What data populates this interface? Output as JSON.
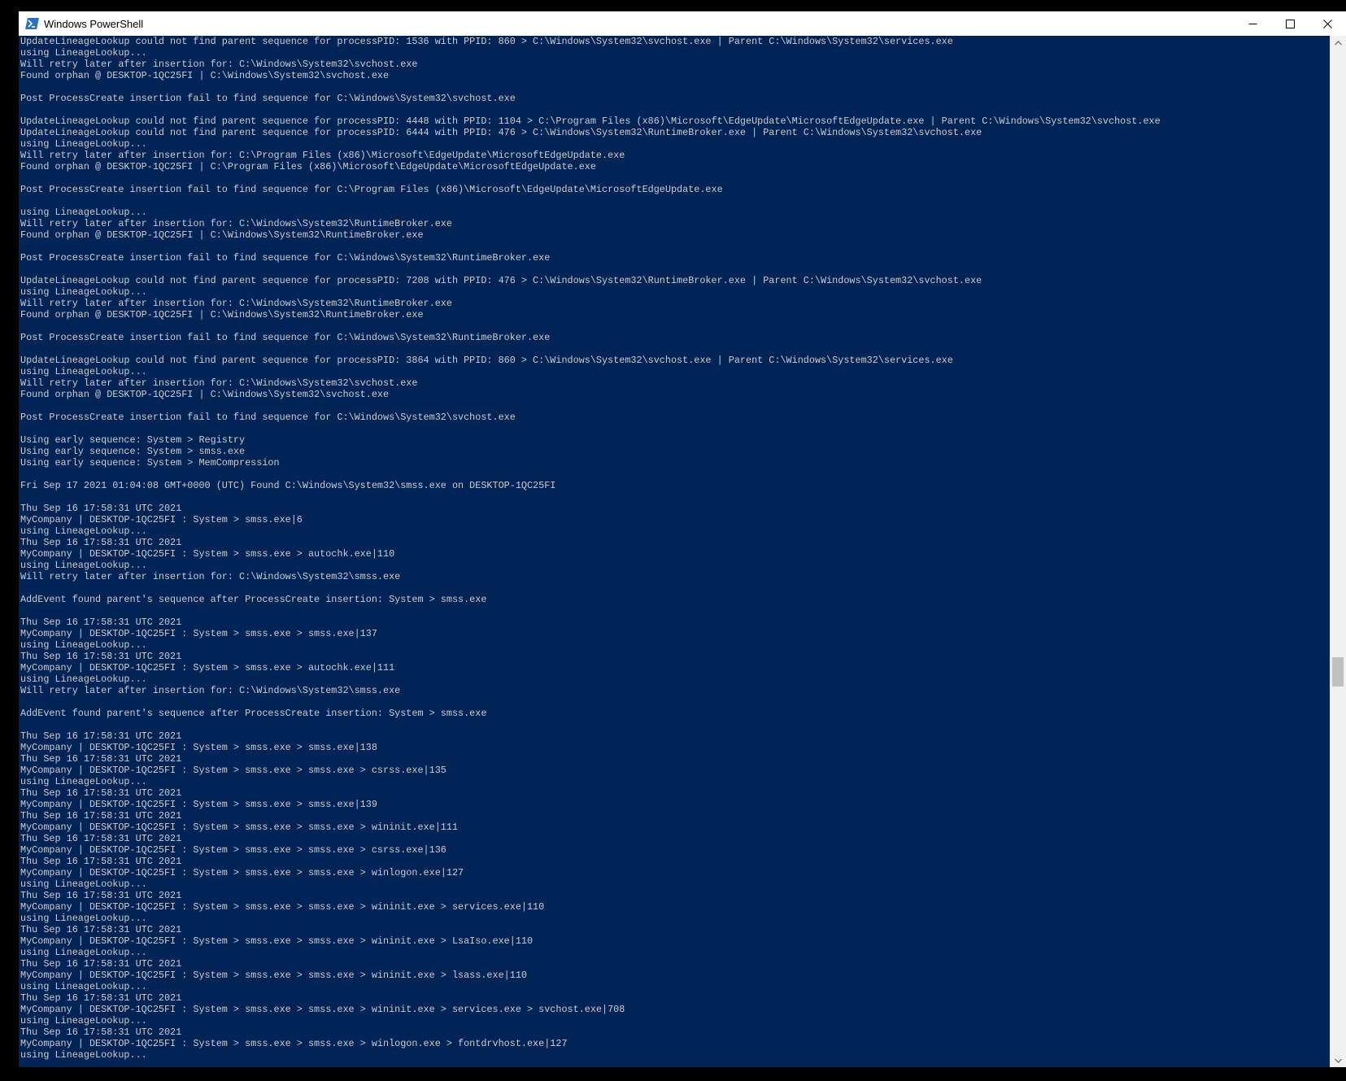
{
  "window": {
    "title": "Windows PowerShell",
    "icon": "powershell-icon",
    "controls": [
      "minimize-icon",
      "maximize-icon",
      "close-icon"
    ]
  },
  "colors": {
    "console_bg": "#012456",
    "console_fg": "#cccccc",
    "titlebar_bg": "#ffffff"
  },
  "console": {
    "lines": [
      "UpdateLineageLookup could not find parent sequence for processPID: 1536 with PPID: 860 > C:\\Windows\\System32\\svchost.exe | Parent C:\\Windows\\System32\\services.exe",
      "using LineageLookup...",
      "Will retry later after insertion for: C:\\Windows\\System32\\svchost.exe",
      "Found orphan @ DESKTOP-1QC25FI | C:\\Windows\\System32\\svchost.exe",
      "",
      "Post ProcessCreate insertion fail to find sequence for C:\\Windows\\System32\\svchost.exe",
      "",
      "UpdateLineageLookup could not find parent sequence for processPID: 4448 with PPID: 1104 > C:\\Program Files (x86)\\Microsoft\\EdgeUpdate\\MicrosoftEdgeUpdate.exe | Parent C:\\Windows\\System32\\svchost.exe",
      "UpdateLineageLookup could not find parent sequence for processPID: 6444 with PPID: 476 > C:\\Windows\\System32\\RuntimeBroker.exe | Parent C:\\Windows\\System32\\svchost.exe",
      "using LineageLookup...",
      "Will retry later after insertion for: C:\\Program Files (x86)\\Microsoft\\EdgeUpdate\\MicrosoftEdgeUpdate.exe",
      "Found orphan @ DESKTOP-1QC25FI | C:\\Program Files (x86)\\Microsoft\\EdgeUpdate\\MicrosoftEdgeUpdate.exe",
      "",
      "Post ProcessCreate insertion fail to find sequence for C:\\Program Files (x86)\\Microsoft\\EdgeUpdate\\MicrosoftEdgeUpdate.exe",
      "",
      "using LineageLookup...",
      "Will retry later after insertion for: C:\\Windows\\System32\\RuntimeBroker.exe",
      "Found orphan @ DESKTOP-1QC25FI | C:\\Windows\\System32\\RuntimeBroker.exe",
      "",
      "Post ProcessCreate insertion fail to find sequence for C:\\Windows\\System32\\RuntimeBroker.exe",
      "",
      "UpdateLineageLookup could not find parent sequence for processPID: 7208 with PPID: 476 > C:\\Windows\\System32\\RuntimeBroker.exe | Parent C:\\Windows\\System32\\svchost.exe",
      "using LineageLookup...",
      "Will retry later after insertion for: C:\\Windows\\System32\\RuntimeBroker.exe",
      "Found orphan @ DESKTOP-1QC25FI | C:\\Windows\\System32\\RuntimeBroker.exe",
      "",
      "Post ProcessCreate insertion fail to find sequence for C:\\Windows\\System32\\RuntimeBroker.exe",
      "",
      "UpdateLineageLookup could not find parent sequence for processPID: 3864 with PPID: 860 > C:\\Windows\\System32\\svchost.exe | Parent C:\\Windows\\System32\\services.exe",
      "using LineageLookup...",
      "Will retry later after insertion for: C:\\Windows\\System32\\svchost.exe",
      "Found orphan @ DESKTOP-1QC25FI | C:\\Windows\\System32\\svchost.exe",
      "",
      "Post ProcessCreate insertion fail to find sequence for C:\\Windows\\System32\\svchost.exe",
      "",
      "Using early sequence: System > Registry",
      "Using early sequence: System > smss.exe",
      "Using early sequence: System > MemCompression",
      "",
      "Fri Sep 17 2021 01:04:08 GMT+0000 (UTC) Found C:\\Windows\\System32\\smss.exe on DESKTOP-1QC25FI",
      "",
      "Thu Sep 16 17:58:31 UTC 2021",
      "MyCompany | DESKTOP-1QC25FI : System > smss.exe|6",
      "using LineageLookup...",
      "Thu Sep 16 17:58:31 UTC 2021",
      "MyCompany | DESKTOP-1QC25FI : System > smss.exe > autochk.exe|110",
      "using LineageLookup...",
      "Will retry later after insertion for: C:\\Windows\\System32\\smss.exe",
      "",
      "AddEvent found parent's sequence after ProcessCreate insertion: System > smss.exe",
      "",
      "Thu Sep 16 17:58:31 UTC 2021",
      "MyCompany | DESKTOP-1QC25FI : System > smss.exe > smss.exe|137",
      "using LineageLookup...",
      "Thu Sep 16 17:58:31 UTC 2021",
      "MyCompany | DESKTOP-1QC25FI : System > smss.exe > autochk.exe|111",
      "using LineageLookup...",
      "Will retry later after insertion for: C:\\Windows\\System32\\smss.exe",
      "",
      "AddEvent found parent's sequence after ProcessCreate insertion: System > smss.exe",
      "",
      "Thu Sep 16 17:58:31 UTC 2021",
      "MyCompany | DESKTOP-1QC25FI : System > smss.exe > smss.exe|138",
      "Thu Sep 16 17:58:31 UTC 2021",
      "MyCompany | DESKTOP-1QC25FI : System > smss.exe > smss.exe > csrss.exe|135",
      "using LineageLookup...",
      "Thu Sep 16 17:58:31 UTC 2021",
      "MyCompany | DESKTOP-1QC25FI : System > smss.exe > smss.exe|139",
      "Thu Sep 16 17:58:31 UTC 2021",
      "MyCompany | DESKTOP-1QC25FI : System > smss.exe > smss.exe > wininit.exe|111",
      "Thu Sep 16 17:58:31 UTC 2021",
      "MyCompany | DESKTOP-1QC25FI : System > smss.exe > smss.exe > csrss.exe|136",
      "Thu Sep 16 17:58:31 UTC 2021",
      "MyCompany | DESKTOP-1QC25FI : System > smss.exe > smss.exe > winlogon.exe|127",
      "using LineageLookup...",
      "Thu Sep 16 17:58:31 UTC 2021",
      "MyCompany | DESKTOP-1QC25FI : System > smss.exe > smss.exe > wininit.exe > services.exe|110",
      "using LineageLookup...",
      "Thu Sep 16 17:58:31 UTC 2021",
      "MyCompany | DESKTOP-1QC25FI : System > smss.exe > smss.exe > wininit.exe > LsaIso.exe|110",
      "using LineageLookup...",
      "Thu Sep 16 17:58:31 UTC 2021",
      "MyCompany | DESKTOP-1QC25FI : System > smss.exe > smss.exe > wininit.exe > lsass.exe|110",
      "using LineageLookup...",
      "Thu Sep 16 17:58:31 UTC 2021",
      "MyCompany | DESKTOP-1QC25FI : System > smss.exe > smss.exe > wininit.exe > services.exe > svchost.exe|708",
      "using LineageLookup...",
      "Thu Sep 16 17:58:31 UTC 2021",
      "MyCompany | DESKTOP-1QC25FI : System > smss.exe > smss.exe > winlogon.exe > fontdrvhost.exe|127",
      "using LineageLookup..."
    ]
  }
}
